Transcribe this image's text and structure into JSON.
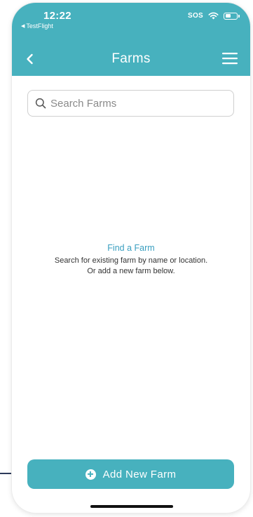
{
  "status_bar": {
    "time": "12:22",
    "back_app": "TestFlight",
    "sos": "SOS"
  },
  "nav": {
    "title": "Farms"
  },
  "search": {
    "placeholder": "Search Farms",
    "value": ""
  },
  "empty_state": {
    "title": "Find a Farm",
    "line1": "Search for existing farm by name or location.",
    "line2": "Or add a new farm below."
  },
  "add_button": {
    "label": "Add New Farm"
  },
  "colors": {
    "brand": "#47b1be",
    "link": "#3a9fc0"
  },
  "icons": [
    "chevron-left-icon",
    "hamburger-menu-icon",
    "search-icon",
    "plus-circle-icon",
    "wifi-icon",
    "battery-icon"
  ]
}
